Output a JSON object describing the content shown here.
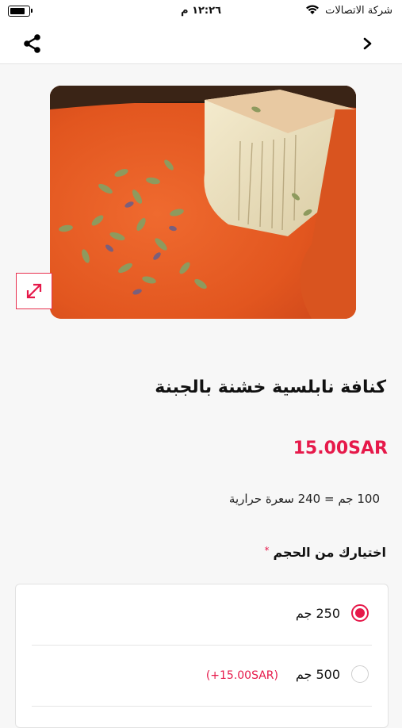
{
  "status_bar": {
    "carrier": "شركة الاتصالات",
    "time": "١٢:٢٦ م"
  },
  "nav": {
    "icons": [
      "share-icon",
      "chevron-right-icon"
    ]
  },
  "product": {
    "title": "كنافة نابلسية خشنة بالجبنة",
    "price": "15.00SAR",
    "calories": "100 جم = 240 سعرة حرارية",
    "image_icon": "expand-icon"
  },
  "size_section": {
    "label": "اختيارك من الحجم",
    "required_mark": "*",
    "options": [
      {
        "label": "250 جم",
        "extra": "",
        "selected": true
      },
      {
        "label": "500 جم",
        "extra": "(+15.00SAR)",
        "selected": false
      }
    ]
  },
  "colors": {
    "accent": "#e6194a",
    "background": "#f7f7f7"
  }
}
